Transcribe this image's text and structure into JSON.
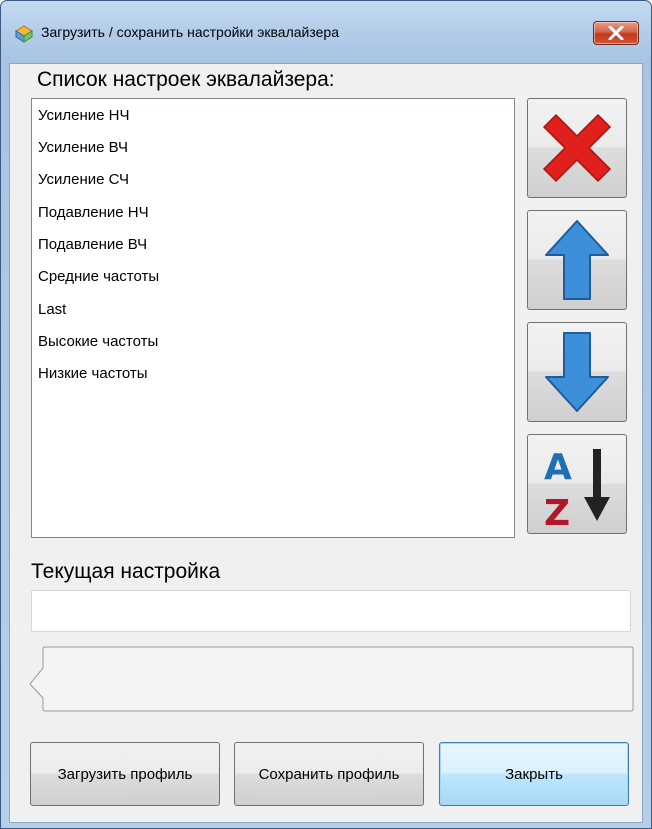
{
  "window": {
    "title": "Загрузить / сохранить настройки эквалайзера"
  },
  "presets": {
    "label": "Список настроек эквалайзера:",
    "items": [
      "Усиление НЧ",
      "Усиление ВЧ",
      "Усиление СЧ",
      "Подавление НЧ",
      "Подавление ВЧ",
      "Средние частоты",
      "Last",
      "Высокие частоты",
      "Низкие частоты"
    ]
  },
  "side_buttons": {
    "delete_icon": "red-x-icon",
    "up_icon": "arrow-up-icon",
    "down_icon": "arrow-down-icon",
    "sort_icon": "sort-az-icon"
  },
  "current": {
    "label": "Текущая настройка",
    "value": ""
  },
  "buttons": {
    "load": "Загрузить профиль",
    "save": "Сохранить профиль",
    "close": "Закрыть"
  },
  "colors": {
    "delete_red": "#e0201c",
    "arrow_blue": "#3c8fd8",
    "sort_blue": "#1f6fb2",
    "sort_red": "#b1172a"
  }
}
